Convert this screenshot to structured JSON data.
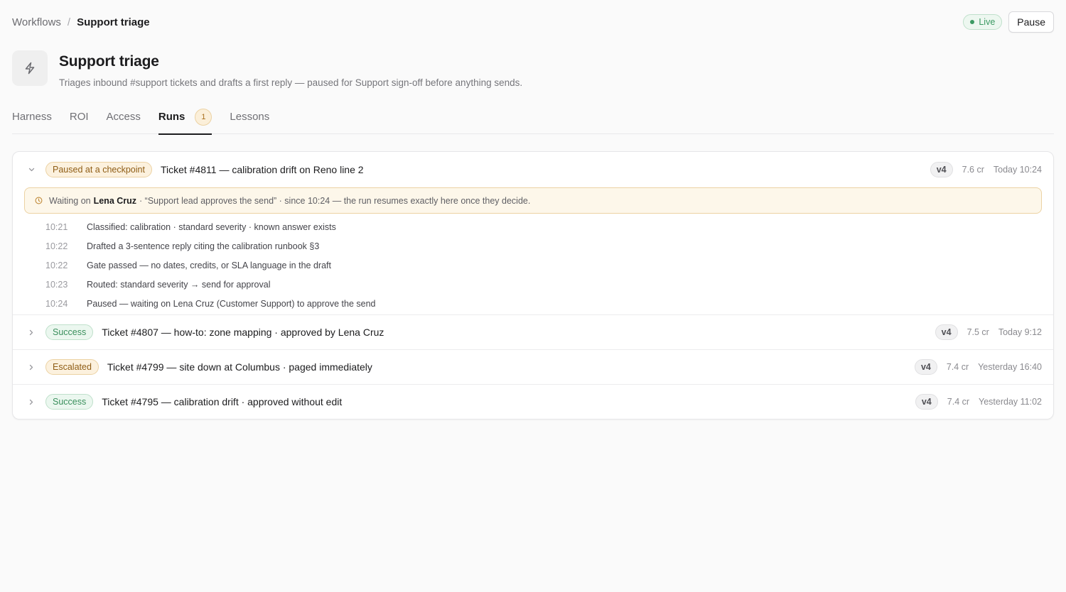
{
  "breadcrumb": {
    "parent": "Workflows",
    "separator": "/",
    "current": "Support triage"
  },
  "status": {
    "live_label": "Live",
    "pause_label": "Pause"
  },
  "workflow": {
    "icon": "bolt-icon",
    "title": "Support triage",
    "description": "Triages inbound #support tickets and drafts a first reply — paused for Support sign-off before anything sends."
  },
  "tabs": [
    {
      "label": "Harness",
      "active": false
    },
    {
      "label": "ROI",
      "active": false
    },
    {
      "label": "Access",
      "active": false
    },
    {
      "label": "Runs",
      "active": true,
      "count": "1"
    },
    {
      "label": "Lessons",
      "active": false
    }
  ],
  "runs": [
    {
      "status": "Paused at a checkpoint",
      "title": "Ticket #4811 — calibration drift on Reno line 2",
      "version": "v4",
      "cost": "7.6 cr",
      "time": "Today 10:24",
      "expanded": true,
      "waiting": {
        "prefix": "Waiting on",
        "who": "Lena Cruz",
        "suffix": "· “Support lead approves the send” · since 10:24 — the run resumes exactly here once they decide."
      },
      "steps": [
        {
          "time": "10:21",
          "text": "Classified: calibration · standard severity · known answer exists"
        },
        {
          "time": "10:22",
          "text": "Drafted a 3-sentence reply citing the calibration runbook §3"
        },
        {
          "time": "10:22",
          "text": "Gate passed — no dates, credits, or SLA language in the draft"
        },
        {
          "time": "10:23",
          "text": "Routed: standard severity → send for approval"
        },
        {
          "time": "10:24",
          "text": "Paused — waiting on Lena Cruz (Customer Support) to approve the send"
        }
      ]
    },
    {
      "status": "Success",
      "title": "Ticket #4807 — how-to: zone mapping · approved by Lena Cruz",
      "version": "v4",
      "cost": "7.5 cr",
      "time": "Today 9:12"
    },
    {
      "status": "Escalated",
      "title": "Ticket #4799 — site down at Columbus · paged immediately",
      "version": "v4",
      "cost": "7.4 cr",
      "time": "Yesterday 16:40"
    },
    {
      "status": "Success",
      "title": "Ticket #4795 — calibration drift · approved without edit",
      "version": "v4",
      "cost": "7.4 cr",
      "time": "Yesterday 11:02"
    }
  ],
  "colors": {
    "live_green": "#3c9a63",
    "amber_badge_bg": "#fcf1de",
    "amber_text": "#8f5d15",
    "success_bg": "#ebf7ef",
    "success_text": "#3a8f5c",
    "waiting_bg": "#fdf7ea"
  }
}
